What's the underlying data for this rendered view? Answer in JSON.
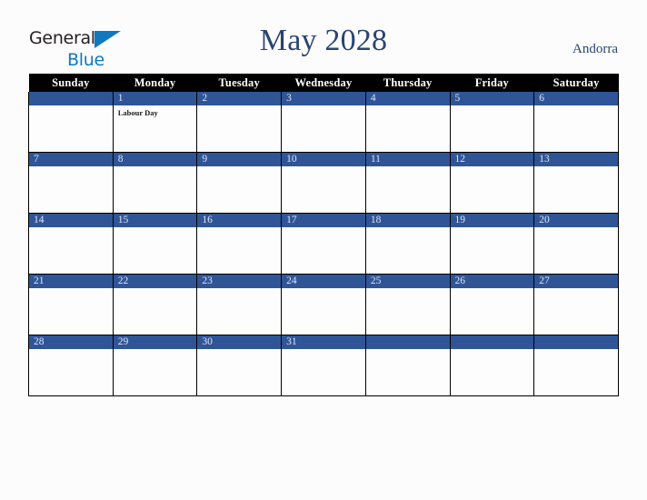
{
  "brand": {
    "name_part1": "General",
    "name_part2": "Blue",
    "triangle_icon": "triangle-icon"
  },
  "header": {
    "title": "May 2028",
    "country": "Andorra"
  },
  "colors": {
    "title_navy": "#2b4470",
    "day_header_bg": "#000000",
    "date_bar_blue": "#2f5597",
    "date_text": "#dfe6f2",
    "logo_blue": "#1278be",
    "page_bg": "#fcfcfd"
  },
  "calendar": {
    "month": "May",
    "year": "2028",
    "weekday_headers": [
      "Sunday",
      "Monday",
      "Tuesday",
      "Wednesday",
      "Thursday",
      "Friday",
      "Saturday"
    ],
    "weeks": [
      [
        {
          "date": "",
          "events": []
        },
        {
          "date": "1",
          "events": [
            "Labour Day"
          ]
        },
        {
          "date": "2",
          "events": []
        },
        {
          "date": "3",
          "events": []
        },
        {
          "date": "4",
          "events": []
        },
        {
          "date": "5",
          "events": []
        },
        {
          "date": "6",
          "events": []
        }
      ],
      [
        {
          "date": "7",
          "events": []
        },
        {
          "date": "8",
          "events": []
        },
        {
          "date": "9",
          "events": []
        },
        {
          "date": "10",
          "events": []
        },
        {
          "date": "11",
          "events": []
        },
        {
          "date": "12",
          "events": []
        },
        {
          "date": "13",
          "events": []
        }
      ],
      [
        {
          "date": "14",
          "events": []
        },
        {
          "date": "15",
          "events": []
        },
        {
          "date": "16",
          "events": []
        },
        {
          "date": "17",
          "events": []
        },
        {
          "date": "18",
          "events": []
        },
        {
          "date": "19",
          "events": []
        },
        {
          "date": "20",
          "events": []
        }
      ],
      [
        {
          "date": "21",
          "events": []
        },
        {
          "date": "22",
          "events": []
        },
        {
          "date": "23",
          "events": []
        },
        {
          "date": "24",
          "events": []
        },
        {
          "date": "25",
          "events": []
        },
        {
          "date": "26",
          "events": []
        },
        {
          "date": "27",
          "events": []
        }
      ],
      [
        {
          "date": "28",
          "events": []
        },
        {
          "date": "29",
          "events": []
        },
        {
          "date": "30",
          "events": []
        },
        {
          "date": "31",
          "events": []
        },
        {
          "date": "",
          "events": []
        },
        {
          "date": "",
          "events": []
        },
        {
          "date": "",
          "events": []
        }
      ]
    ]
  }
}
